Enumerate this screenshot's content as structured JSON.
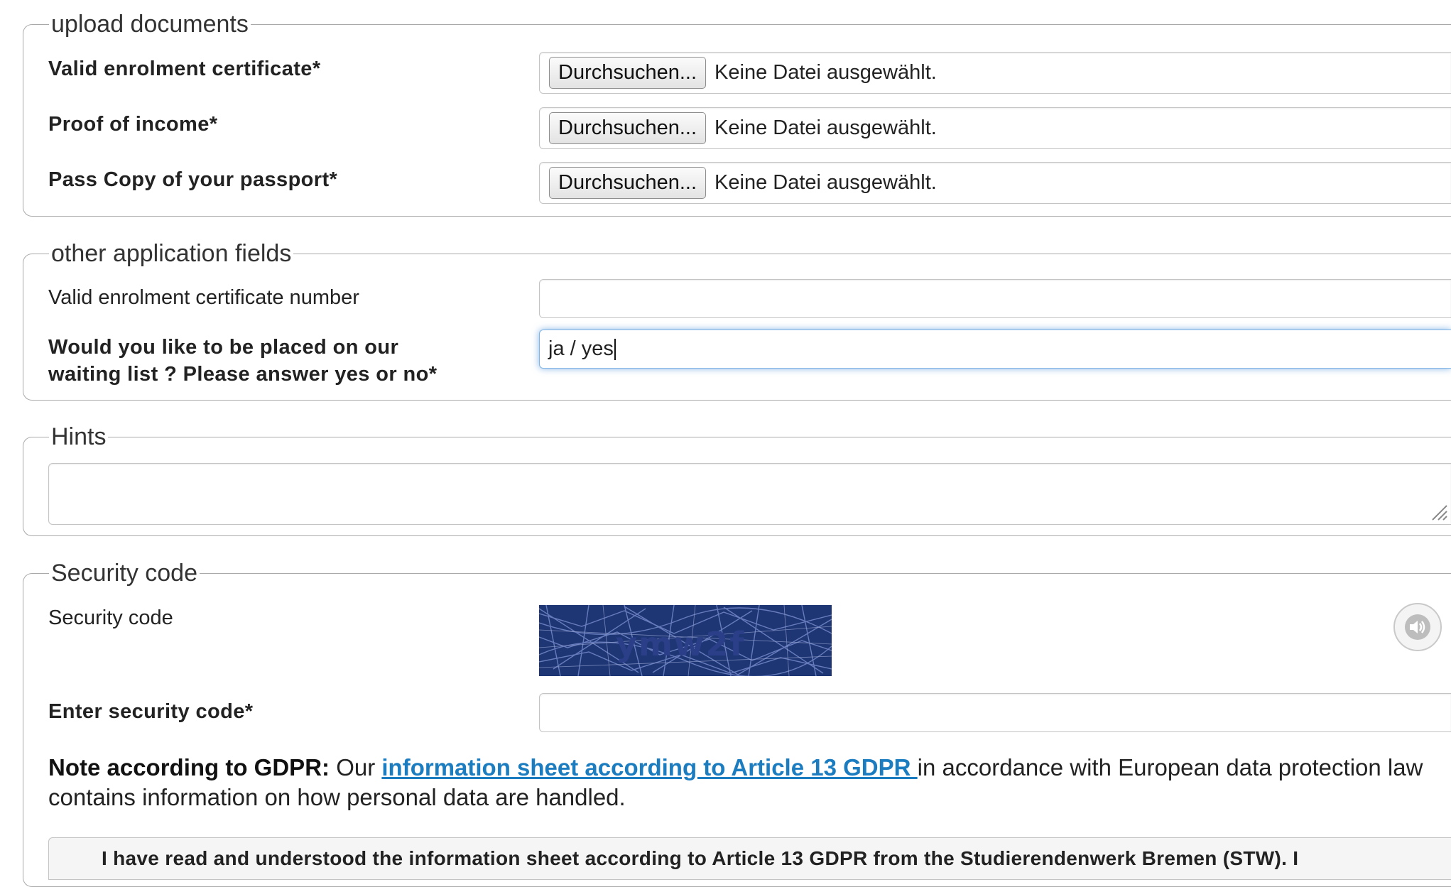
{
  "sections": {
    "upload": {
      "legend": "upload documents",
      "rows": [
        {
          "label": "Valid enrolment certificate*",
          "button": "Durchsuchen...",
          "status": "Keine Datei ausgewählt."
        },
        {
          "label": "Proof of income*",
          "button": "Durchsuchen...",
          "status": "Keine Datei ausgewählt."
        },
        {
          "label": "Pass Copy of your passport*",
          "button": "Durchsuchen...",
          "status": "Keine Datei ausgewählt."
        }
      ]
    },
    "other": {
      "legend": "other application fields",
      "enrolment_number_label": "Valid enrolment certificate number",
      "enrolment_number_value": "",
      "waiting_list_label_line1": "Would you like to be placed on our",
      "waiting_list_label_line2": "waiting list ? Please answer yes or no*",
      "waiting_list_value": "ja / yes"
    },
    "hints": {
      "legend": "Hints",
      "value": ""
    },
    "security": {
      "legend": "Security code",
      "captcha_label": "Security code",
      "captcha_text": "ymw2f",
      "enter_label": "Enter security code*",
      "enter_value": ""
    }
  },
  "gdpr": {
    "note_prefix": "Note according to GDPR:",
    "text_before_link": " Our ",
    "link_text": "information sheet according to Article 13 GDPR ",
    "text_after_link": "in accordance with European data protection law contains information on how personal data are handled.",
    "consent_text": "I have read and understood the information sheet according to Article 13 GDPR from the Studierendenwerk Bremen (STW). I"
  },
  "colors": {
    "link": "#1b7cc0",
    "captcha_bg": "#1f3675",
    "focus_glow": "#5296dc"
  },
  "icons": {
    "audio": "speaker-icon",
    "resize": "resize-grip-icon"
  }
}
